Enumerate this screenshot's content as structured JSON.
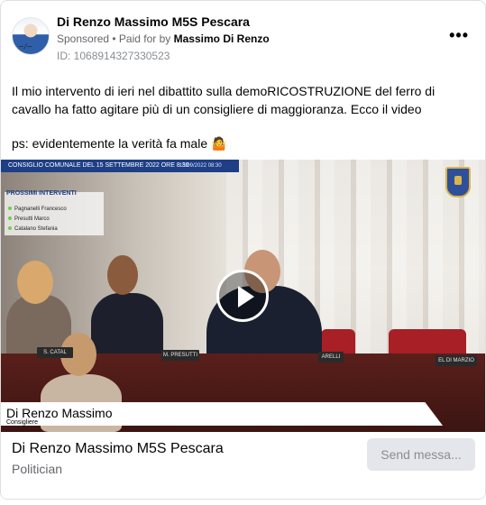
{
  "post": {
    "page_name": "Di Renzo Massimo M5S Pescara",
    "sponsored_label": "Sponsored",
    "paid_for_prefix": "• Paid for by",
    "paid_for_name": "Massimo Di Renzo",
    "ad_id": "ID: 1068914327330523",
    "more_label": "•••",
    "text_paragraph_1": "Il mio intervento di ieri nel dibattito sulla demoRICOSTRUZIONE del ferro di cavallo ha fatto agitare più di un consigliere di maggioranza. Ecco il video",
    "text_paragraph_2": "ps: evidentemente la verità fa male 🤷"
  },
  "video": {
    "topbar_title": "CONSIGLIO COMUNALE DEL 15 SETTEMBRE 2022 ORE 8:30",
    "topbar_date": "15/09/2022 08:30",
    "prossimi_title": "PROSSIMI INTERVENTI",
    "prossimi": [
      "Pagnanelli Francesco",
      "Presutti Marco",
      "Catalano Stefania"
    ],
    "nameplates": [
      "S. CATAL",
      "M. PRESUTTI",
      "ARELLI",
      "EL DI MARZIO"
    ],
    "lower_third_name": "Di Renzo Massimo",
    "lower_third_role": "Consigliere"
  },
  "footer": {
    "name": "Di Renzo Massimo M5S Pescara",
    "category": "Politician",
    "send_button": "Send messa..."
  }
}
